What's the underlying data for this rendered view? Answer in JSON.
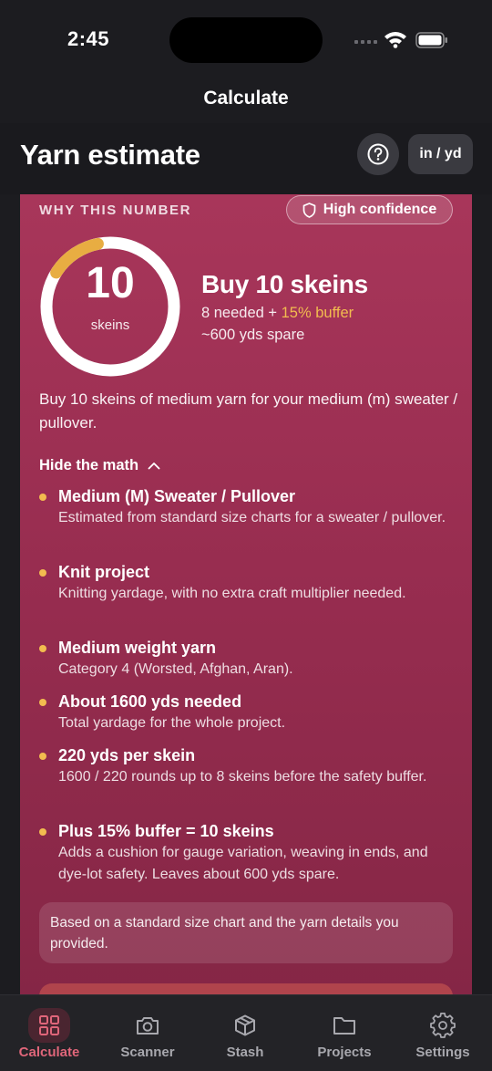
{
  "status_bar": {
    "time": "2:45"
  },
  "nav": {
    "title": "Calculate"
  },
  "header": {
    "title": "Yarn estimate",
    "units_label": "in / yd"
  },
  "card": {
    "section_label": "WHY THIS NUMBER",
    "confidence": "High confidence",
    "ring": {
      "value": "10",
      "unit": "skeins",
      "progress_fraction": 0.13
    },
    "buy_title": "Buy 10 skeins",
    "needed_text": "8 needed + ",
    "buffer_text": "15% buffer",
    "spare_text": "~600 yds spare",
    "summary": "Buy 10 skeins of medium yarn for your medium (m) sweater / pullover.",
    "toggle_label": "Hide the math",
    "items": [
      {
        "title": "Medium (M) Sweater / Pullover",
        "desc": "Estimated from standard size charts for a sweater / pullover."
      },
      {
        "title": "Knit project",
        "desc": "Knitting yardage, with no extra craft multiplier needed."
      },
      {
        "title": "Medium weight yarn",
        "desc": "Category 4 (Worsted, Afghan, Aran)."
      },
      {
        "title": "About 1600 yds needed",
        "desc": "Total yardage for the whole project."
      },
      {
        "title": "220 yds per skein",
        "desc": "1600 / 220 rounds up to 8 skeins before the safety buffer."
      },
      {
        "title": "Plus 15% buffer = 10 skeins",
        "desc": "Adds a cushion for gauge variation, weaving in ends, and dye-lot safety. Leaves about 600 yds spare."
      }
    ],
    "note": "Based on a standard size chart and the yarn details you provided."
  },
  "tabs": [
    {
      "label": "Calculate",
      "icon": "grid-icon",
      "active": true
    },
    {
      "label": "Scanner",
      "icon": "camera-icon",
      "active": false
    },
    {
      "label": "Stash",
      "icon": "box-icon",
      "active": false
    },
    {
      "label": "Projects",
      "icon": "folder-icon",
      "active": false
    },
    {
      "label": "Settings",
      "icon": "gear-icon",
      "active": false
    }
  ],
  "colors": {
    "accent": "#e0667a",
    "buffer": "#f2bc4f",
    "card_top": "#a8365a",
    "card_bottom": "#842645",
    "background": "#1c1c20"
  }
}
